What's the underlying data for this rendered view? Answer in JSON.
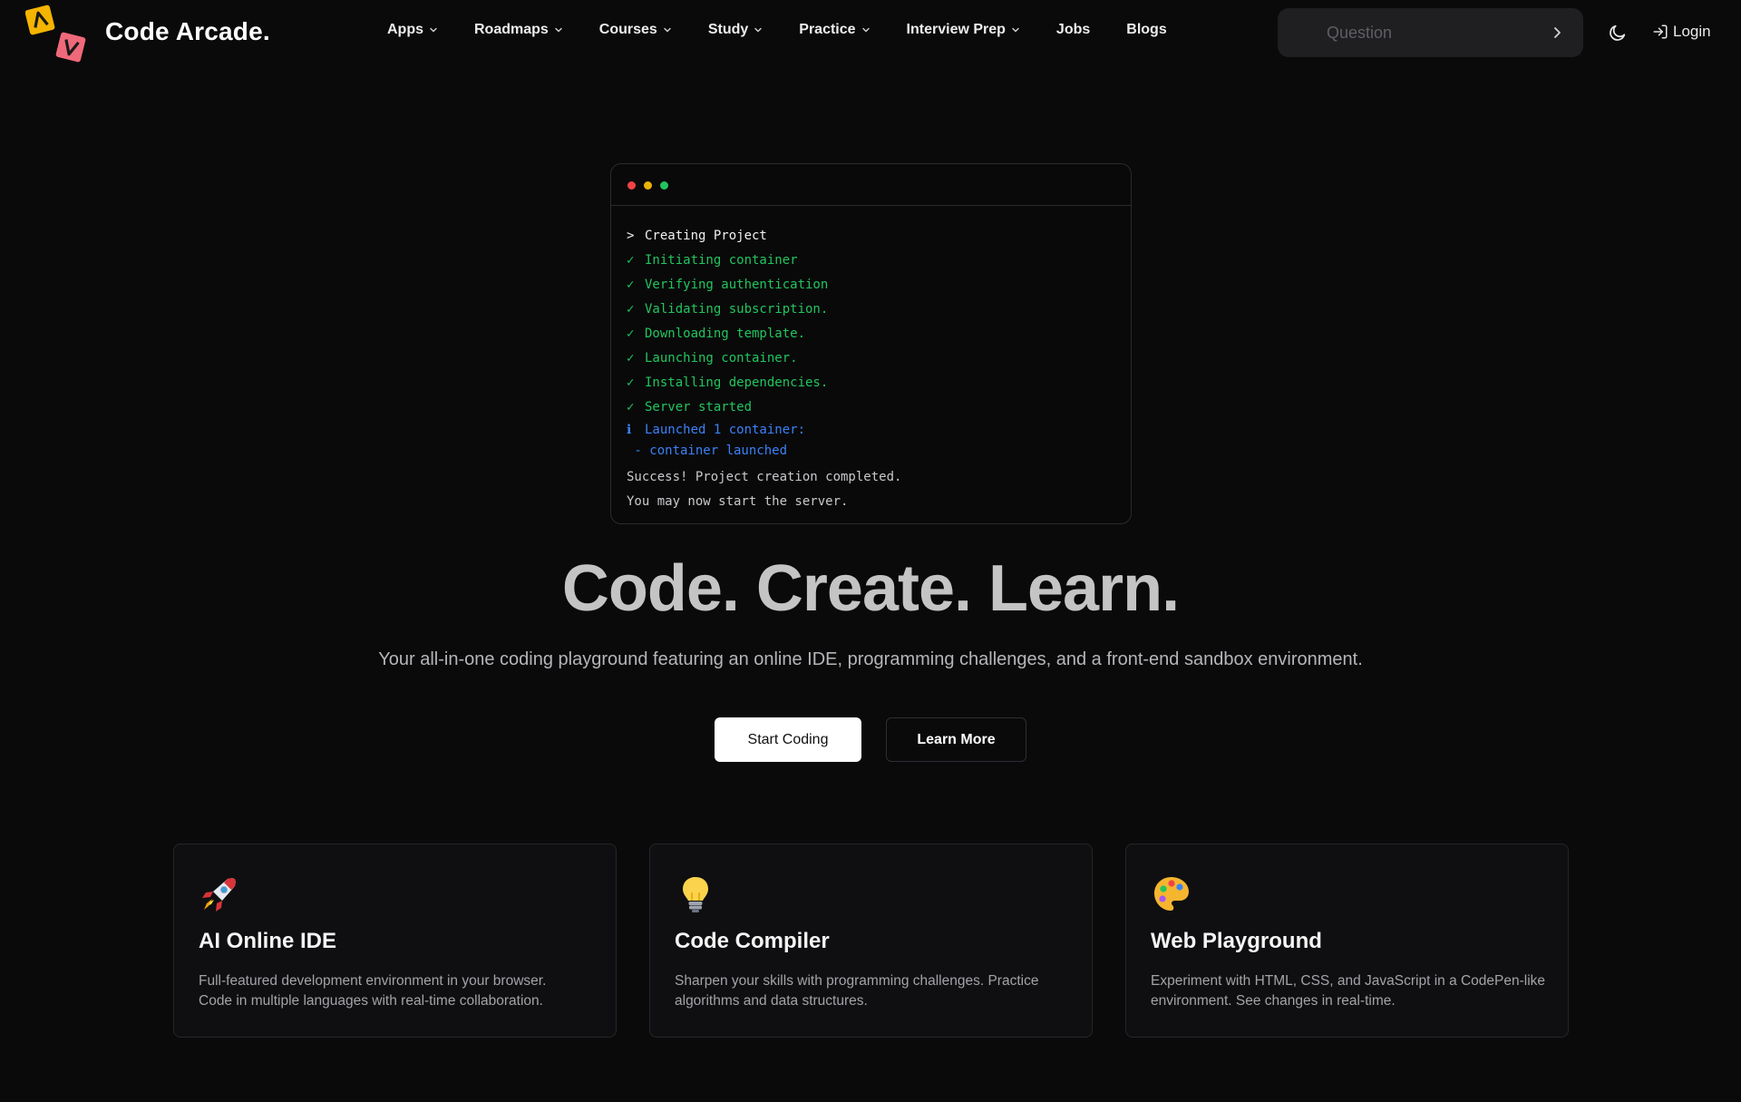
{
  "header": {
    "brand": "Code Arcade.",
    "nav": [
      {
        "label": "Apps",
        "dropdown": true
      },
      {
        "label": "Roadmaps",
        "dropdown": true
      },
      {
        "label": "Courses",
        "dropdown": true
      },
      {
        "label": "Study",
        "dropdown": true
      },
      {
        "label": "Practice",
        "dropdown": true
      },
      {
        "label": "Interview Prep",
        "dropdown": true
      },
      {
        "label": "Jobs",
        "dropdown": false
      },
      {
        "label": "Blogs",
        "dropdown": false
      }
    ],
    "search": {
      "placeholder": "Question",
      "value": ""
    },
    "theme_icon": "moon-icon",
    "login_label": "Login",
    "login_icon": "log-in-icon"
  },
  "terminal": {
    "lines": [
      {
        "kind": "cmd",
        "mark": ">",
        "text": "Creating Project"
      },
      {
        "kind": "ok",
        "mark": "✓",
        "text": "Initiating container"
      },
      {
        "kind": "ok",
        "mark": "✓",
        "text": "Verifying authentication"
      },
      {
        "kind": "ok",
        "mark": "✓",
        "text": "Validating subscription."
      },
      {
        "kind": "ok",
        "mark": "✓",
        "text": "Downloading template."
      },
      {
        "kind": "ok",
        "mark": "✓",
        "text": "Launching container."
      },
      {
        "kind": "ok",
        "mark": "✓",
        "text": "Installing dependencies."
      },
      {
        "kind": "ok",
        "mark": "✓",
        "text": "Server started"
      },
      {
        "kind": "info",
        "mark": "ℹ",
        "text": "Launched 1 container:"
      },
      {
        "kind": "info",
        "mark": "",
        "text": " - container launched"
      },
      {
        "kind": "plain",
        "mark": "",
        "text": "Success! Project creation completed."
      },
      {
        "kind": "plain",
        "mark": "",
        "text": "You may now start the server."
      }
    ]
  },
  "hero": {
    "title": "Code. Create. Learn.",
    "subtitle": "Your all-in-one coding playground featuring an online IDE, programming challenges, and a front-end sandbox environment.",
    "primary_button": "Start Coding",
    "secondary_button": "Learn More"
  },
  "cards": [
    {
      "icon": "rocket-icon",
      "title": "AI Online IDE",
      "description_lines": [
        "Full-featured development environment in your browser.",
        "Code in multiple languages with real-time collaboration."
      ]
    },
    {
      "icon": "lightbulb-icon",
      "title": "Code Compiler",
      "description_lines": [
        "Sharpen your skills with programming challenges. Practice",
        "algorithms and data structures."
      ]
    },
    {
      "icon": "palette-icon",
      "title": "Web Playground",
      "description_lines": [
        "Experiment with HTML, CSS, and JavaScript in a CodePen-like",
        "environment. See changes in real-time."
      ]
    }
  ],
  "colors": {
    "background": "#0a0a0b",
    "terminal_ok": "#22c55e",
    "terminal_info": "#3b82f6",
    "logo_yellow": "#f5b400",
    "logo_pink": "#f0697a"
  }
}
